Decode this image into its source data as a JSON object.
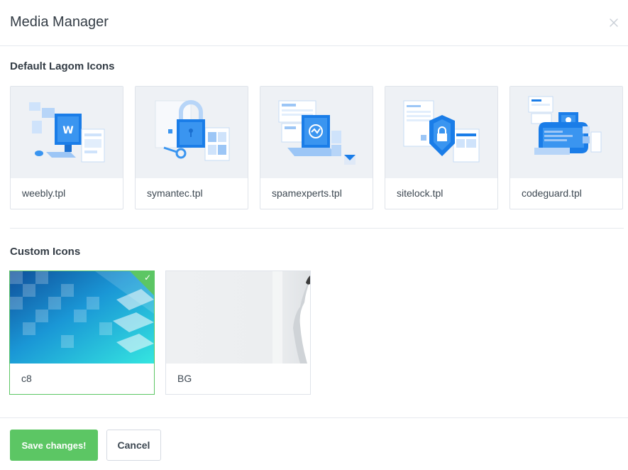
{
  "modal": {
    "title": "Media Manager",
    "close_icon": "close-icon"
  },
  "default_section": {
    "title": "Default Lagom Icons",
    "items": [
      {
        "label": "weebly.tpl",
        "icon": "weebly-illustration-icon"
      },
      {
        "label": "symantec.tpl",
        "icon": "symantec-lock-illustration-icon"
      },
      {
        "label": "spamexperts.tpl",
        "icon": "spamexperts-laptop-illustration-icon"
      },
      {
        "label": "sitelock.tpl",
        "icon": "sitelock-shield-illustration-icon"
      },
      {
        "label": "codeguard.tpl",
        "icon": "codeguard-illustration-icon"
      }
    ]
  },
  "custom_section": {
    "title": "Custom Icons",
    "items": [
      {
        "label": "c8",
        "selected": true
      },
      {
        "label": "BG",
        "selected": false
      }
    ]
  },
  "footer": {
    "save_label": "Save changes!",
    "cancel_label": "Cancel"
  },
  "colors": {
    "accent_green": "#5cc664",
    "illustration_blue": "#1a7de8",
    "thumb_bg": "#eef1f5"
  }
}
